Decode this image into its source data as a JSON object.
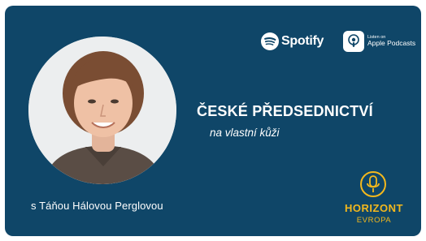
{
  "banner": {
    "title": "ČESKÉ PŘEDSEDNICTVÍ",
    "subtitle": "na vlastní kůži",
    "guest_caption": "s Táňou Hálovou Perglovou"
  },
  "platforms": {
    "spotify_label": "Spotify",
    "apple_small": "Listen on",
    "apple_label": "Apple Podcasts"
  },
  "logo": {
    "name": "HORIZONT",
    "sub": "EVROPA"
  },
  "colors": {
    "background": "#0f4668",
    "accent": "#f3b81d"
  }
}
